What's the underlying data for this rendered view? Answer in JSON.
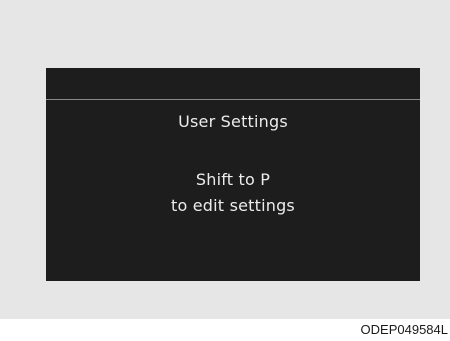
{
  "screen": {
    "title": "User Settings",
    "message_line1": "Shift to P",
    "message_line2": "to edit settings"
  },
  "caption": {
    "code": "ODEP049584L"
  },
  "colors": {
    "frame_background": "#e6e6e6",
    "display_background": "#1d1d1d",
    "display_text": "#ececec",
    "divider": "#8a8a8a"
  }
}
